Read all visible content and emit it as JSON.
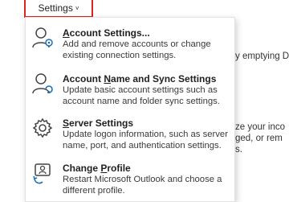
{
  "ribbon": {
    "settings_label": "Settings",
    "chevron": "˅"
  },
  "background_text": {
    "line1": "y emptying D",
    "line2": "ze your inco",
    "line3": "ged, or rem",
    "line4": "s."
  },
  "menu": {
    "items": [
      {
        "icon": "account-settings-icon",
        "title": "Account Settings...",
        "mnemonic": "A",
        "rest": "ccount Settings...",
        "description": "Add and remove accounts or change existing connection settings."
      },
      {
        "icon": "name-sync-icon",
        "title": "Account Name and Sync Settings",
        "mnemonic": "N",
        "pre": "Account ",
        "rest": "ame and Sync Settings",
        "description": "Update basic account settings such as account name and folder sync settings."
      },
      {
        "icon": "server-settings-gear-icon",
        "title": "Server Settings",
        "mnemonic": "S",
        "rest": "erver Settings",
        "description": "Update logon information, such as server name, port, and authentication settings."
      },
      {
        "icon": "change-profile-icon",
        "title": "Change Profile",
        "pre": "Change ",
        "mnemonic": "P",
        "rest": "rofile",
        "description": "Restart Microsoft Outlook and choose a different profile."
      }
    ]
  }
}
